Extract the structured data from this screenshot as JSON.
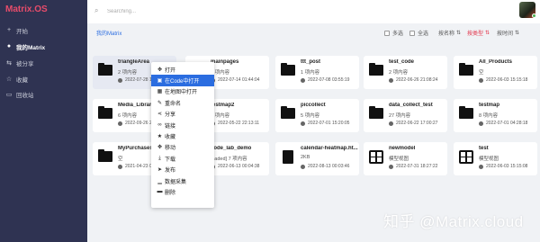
{
  "app": {
    "title": "Matrix.OS"
  },
  "sidebar": {
    "items": [
      {
        "label": "开始",
        "icon": "plus-icon"
      },
      {
        "label": "我的Matrix",
        "icon": "user-icon",
        "active": true
      },
      {
        "label": "被分享",
        "icon": "share-icon"
      },
      {
        "label": "收藏",
        "icon": "star-icon"
      },
      {
        "label": "回收站",
        "icon": "trash-icon"
      }
    ]
  },
  "search": {
    "placeholder": "Searching...",
    "value": ""
  },
  "toolbar": {
    "breadcrumb": "我的Matrix",
    "multi_select": "多选",
    "select_all": "全选",
    "sort_name": "按名称",
    "sort_type": "按类型",
    "sort_time": "按时间",
    "sort_arrow": "⇅"
  },
  "cards": [
    {
      "name": "triangleArea",
      "count": "2 项内容",
      "date": "2022-07-28 1...",
      "icon": "folder"
    },
    {
      "name": "mainpages",
      "count": "4 项内容",
      "date": "2022-07-14 01:44:04",
      "icon": "folder"
    },
    {
      "name": "ttt_post",
      "count": "1 项内容",
      "date": "2022-07-08 03:55:19",
      "icon": "folder"
    },
    {
      "name": "test_code",
      "count": "2 项内容",
      "date": "2022-06-26 21:08:24",
      "icon": "folder"
    },
    {
      "name": "All_Products",
      "count": "空",
      "date": "2022-06-03 15:15:18",
      "icon": "folder"
    },
    {
      "name": "Media_Library",
      "count": "6 项内容",
      "date": "2022-09-26 2...",
      "icon": "folder"
    },
    {
      "name": "testmap2",
      "count": "9 项内容",
      "date": "2022-05-22 22:13:11",
      "icon": "folder"
    },
    {
      "name": "piccollect",
      "count": "5 项内容",
      "date": "2022-07-01 15:20:05",
      "icon": "folder"
    },
    {
      "name": "data_collect_test",
      "count": "27 项内容",
      "date": "2022-06-22 17:00:27",
      "icon": "folder"
    },
    {
      "name": "testmap",
      "count": "8 项内容",
      "date": "2022-07-01 04:28:18",
      "icon": "folder"
    },
    {
      "name": "MyPurchases",
      "count": "空",
      "date": "2021-04-23 0...",
      "icon": "folder"
    },
    {
      "name": "code_lab_demo",
      "count": "loaded] 7 项内容",
      "date": "2022-06-13 00:04:38",
      "icon": "folder"
    },
    {
      "name": "calendar-heatmap.ht...",
      "count": "2KB",
      "date": "2022-08-13 00:03:46",
      "icon": "file"
    },
    {
      "name": "newmodel",
      "count": "模型视图",
      "date": "2022-07-31 18:27:22",
      "icon": "grid"
    },
    {
      "name": "test",
      "count": "模型视图",
      "date": "2022-06-03 15:15:08",
      "icon": "grid"
    }
  ],
  "context_menu": {
    "items": [
      {
        "label": "打开",
        "icon": "move-icon"
      },
      {
        "label": "在Code中打开",
        "icon": "code-icon",
        "active": true
      },
      {
        "label": "在地图中打开",
        "icon": "map-icon"
      },
      {
        "label": "重命名",
        "icon": "edit-icon"
      },
      {
        "label": "分享",
        "icon": "share-icon"
      },
      {
        "label": "链接",
        "icon": "link-icon"
      },
      {
        "label": "收藏",
        "icon": "star-icon"
      },
      {
        "label": "移动",
        "icon": "move-icon"
      },
      {
        "label": "下载",
        "icon": "download-icon"
      },
      {
        "label": "发布",
        "icon": "publish-icon"
      },
      {
        "label": "数据采集",
        "icon": "chart-icon"
      },
      {
        "label": "删除",
        "icon": "trash-icon"
      }
    ]
  },
  "watermark": "知乎 @Matrix.cloud",
  "colors": {
    "sidebar_bg": "#2f3352",
    "accent": "#2b6de0",
    "brand": "#e84c6b",
    "sort_active": "#e2344a"
  }
}
